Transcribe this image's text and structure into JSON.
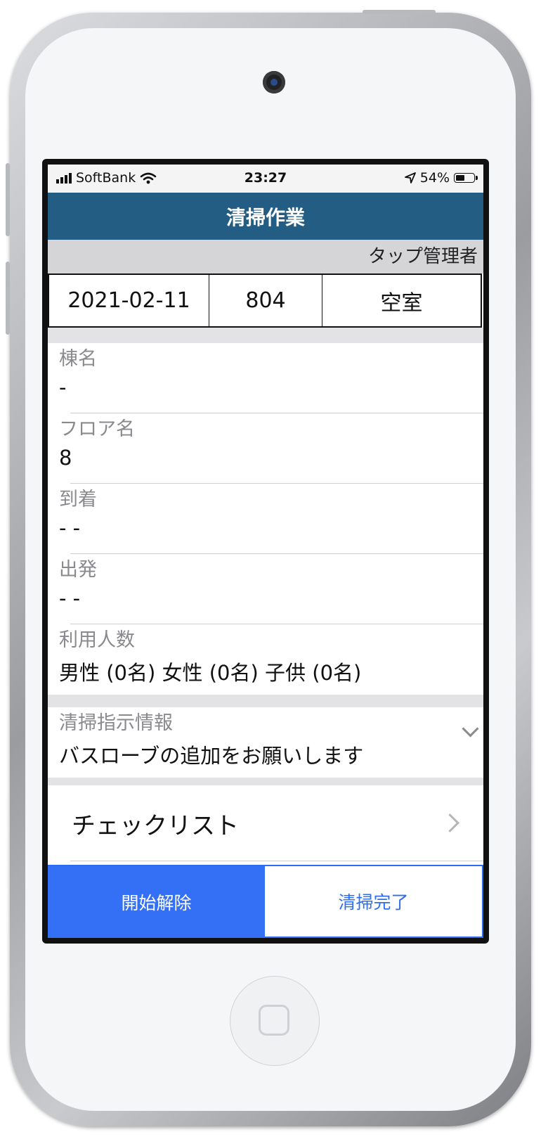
{
  "status_bar": {
    "carrier": "SoftBank",
    "time": "23:27",
    "battery_percent": "54%",
    "battery_level": 0.54,
    "icons": [
      "signal-bars-icon",
      "wifi-icon",
      "location-arrow-icon",
      "battery-icon"
    ]
  },
  "header": {
    "title": "清掃作業"
  },
  "user": {
    "name": "タップ管理者"
  },
  "room_info": {
    "date": "2021-02-11",
    "room_number": "804",
    "status": "空室"
  },
  "fields": {
    "building": {
      "label": "棟名",
      "value": "-"
    },
    "floor": {
      "label": "フロア名",
      "value": "8"
    },
    "arrival": {
      "label": "到着",
      "value": "- -"
    },
    "departure": {
      "label": "出発",
      "value": "- -"
    },
    "guests": {
      "label": "利用人数",
      "value": "男性 (0名) 女性 (0名) 子供 (0名)"
    }
  },
  "instructions": {
    "label": "清掃指示情報",
    "value": "バスローブの追加をお願いします"
  },
  "checklist": {
    "label": "チェックリスト"
  },
  "actions": {
    "start_cancel_label": "開始解除",
    "complete_label": "清掃完了"
  },
  "colors": {
    "header_bg": "#245d83",
    "primary_button": "#3470f6",
    "accent_text": "#2f6ef0"
  }
}
